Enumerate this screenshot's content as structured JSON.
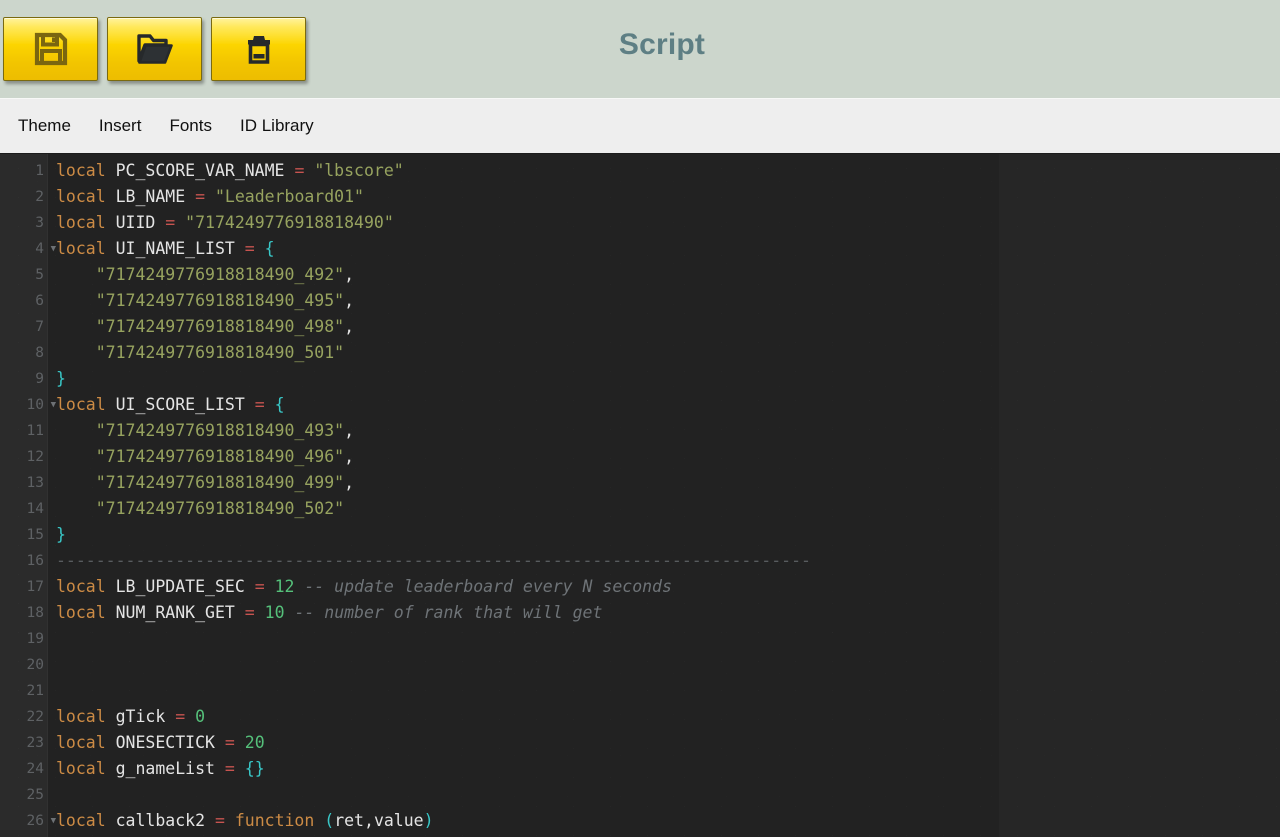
{
  "window": {
    "title": "Script",
    "title_color": "#5e7f84",
    "header_bg": "#ccd6cc",
    "menubar_bg": "#eeeeee",
    "editor_bg": "#222222",
    "gutter_bg": "#2b2b2b"
  },
  "toolbar": {
    "buttons": [
      {
        "name": "save-button",
        "icon": "floppy-disk-icon",
        "label": "Save"
      },
      {
        "name": "open-button",
        "icon": "folder-open-icon",
        "label": "Open"
      },
      {
        "name": "delete-button",
        "icon": "trash-can-icon",
        "label": "Delete"
      }
    ]
  },
  "menu": {
    "items": [
      {
        "label": "Theme"
      },
      {
        "label": "Insert"
      },
      {
        "label": "Fonts"
      },
      {
        "label": "ID Library"
      }
    ]
  },
  "editor": {
    "language": "lua",
    "first_line": 1,
    "last_line": 26,
    "fold_markers": [
      4,
      10,
      26
    ],
    "syntax_colors": {
      "keyword": "#cc8b45",
      "identifier": "#e4e4e4",
      "operator": "#c75450",
      "string": "#97a35f",
      "number": "#55c07a",
      "brace": "#39c8c8",
      "comment": "#6e7377",
      "linenumber": "#5e6164"
    },
    "lines": [
      {
        "n": 1,
        "tokens": [
          {
            "t": "kw",
            "v": "local"
          },
          {
            "t": "pun",
            "v": " "
          },
          {
            "t": "id",
            "v": "PC_SCORE_VAR_NAME"
          },
          {
            "t": "pun",
            "v": " "
          },
          {
            "t": "op",
            "v": "="
          },
          {
            "t": "pun",
            "v": " "
          },
          {
            "t": "str",
            "v": "\"lbscore\""
          }
        ]
      },
      {
        "n": 2,
        "tokens": [
          {
            "t": "kw",
            "v": "local"
          },
          {
            "t": "pun",
            "v": " "
          },
          {
            "t": "id",
            "v": "LB_NAME"
          },
          {
            "t": "pun",
            "v": " "
          },
          {
            "t": "op",
            "v": "="
          },
          {
            "t": "pun",
            "v": " "
          },
          {
            "t": "str",
            "v": "\"Leaderboard01\""
          }
        ]
      },
      {
        "n": 3,
        "tokens": [
          {
            "t": "kw",
            "v": "local"
          },
          {
            "t": "pun",
            "v": " "
          },
          {
            "t": "id",
            "v": "UIID"
          },
          {
            "t": "pun",
            "v": " "
          },
          {
            "t": "op",
            "v": "="
          },
          {
            "t": "pun",
            "v": " "
          },
          {
            "t": "str",
            "v": "\"7174249776918818490\""
          }
        ]
      },
      {
        "n": 4,
        "tokens": [
          {
            "t": "kw",
            "v": "local"
          },
          {
            "t": "pun",
            "v": " "
          },
          {
            "t": "id",
            "v": "UI_NAME_LIST"
          },
          {
            "t": "pun",
            "v": " "
          },
          {
            "t": "op",
            "v": "="
          },
          {
            "t": "pun",
            "v": " "
          },
          {
            "t": "brc",
            "v": "{"
          }
        ]
      },
      {
        "n": 5,
        "tokens": [
          {
            "t": "pun",
            "v": "    "
          },
          {
            "t": "str",
            "v": "\"7174249776918818490_492\""
          },
          {
            "t": "pun",
            "v": ","
          }
        ]
      },
      {
        "n": 6,
        "tokens": [
          {
            "t": "pun",
            "v": "    "
          },
          {
            "t": "str",
            "v": "\"7174249776918818490_495\""
          },
          {
            "t": "pun",
            "v": ","
          }
        ]
      },
      {
        "n": 7,
        "tokens": [
          {
            "t": "pun",
            "v": "    "
          },
          {
            "t": "str",
            "v": "\"7174249776918818490_498\""
          },
          {
            "t": "pun",
            "v": ","
          }
        ]
      },
      {
        "n": 8,
        "tokens": [
          {
            "t": "pun",
            "v": "    "
          },
          {
            "t": "str",
            "v": "\"7174249776918818490_501\""
          }
        ]
      },
      {
        "n": 9,
        "tokens": [
          {
            "t": "brc",
            "v": "}"
          }
        ]
      },
      {
        "n": 10,
        "tokens": [
          {
            "t": "kw",
            "v": "local"
          },
          {
            "t": "pun",
            "v": " "
          },
          {
            "t": "id",
            "v": "UI_SCORE_LIST"
          },
          {
            "t": "pun",
            "v": " "
          },
          {
            "t": "op",
            "v": "="
          },
          {
            "t": "pun",
            "v": " "
          },
          {
            "t": "brc",
            "v": "{"
          }
        ]
      },
      {
        "n": 11,
        "tokens": [
          {
            "t": "pun",
            "v": "    "
          },
          {
            "t": "str",
            "v": "\"7174249776918818490_493\""
          },
          {
            "t": "pun",
            "v": ","
          }
        ]
      },
      {
        "n": 12,
        "tokens": [
          {
            "t": "pun",
            "v": "    "
          },
          {
            "t": "str",
            "v": "\"7174249776918818490_496\""
          },
          {
            "t": "pun",
            "v": ","
          }
        ]
      },
      {
        "n": 13,
        "tokens": [
          {
            "t": "pun",
            "v": "    "
          },
          {
            "t": "str",
            "v": "\"7174249776918818490_499\""
          },
          {
            "t": "pun",
            "v": ","
          }
        ]
      },
      {
        "n": 14,
        "tokens": [
          {
            "t": "pun",
            "v": "    "
          },
          {
            "t": "str",
            "v": "\"7174249776918818490_502\""
          }
        ]
      },
      {
        "n": 15,
        "tokens": [
          {
            "t": "brc",
            "v": "}"
          }
        ]
      },
      {
        "n": 16,
        "tokens": [
          {
            "t": "comd",
            "v": "----------------------------------------------------------------------------"
          }
        ]
      },
      {
        "n": 17,
        "tokens": [
          {
            "t": "kw",
            "v": "local"
          },
          {
            "t": "pun",
            "v": " "
          },
          {
            "t": "id",
            "v": "LB_UPDATE_SEC"
          },
          {
            "t": "pun",
            "v": " "
          },
          {
            "t": "op",
            "v": "="
          },
          {
            "t": "pun",
            "v": " "
          },
          {
            "t": "num",
            "v": "12"
          },
          {
            "t": "pun",
            "v": " "
          },
          {
            "t": "com",
            "v": "-- update leaderboard every N seconds"
          }
        ]
      },
      {
        "n": 18,
        "tokens": [
          {
            "t": "kw",
            "v": "local"
          },
          {
            "t": "pun",
            "v": " "
          },
          {
            "t": "id",
            "v": "NUM_RANK_GET"
          },
          {
            "t": "pun",
            "v": " "
          },
          {
            "t": "op",
            "v": "="
          },
          {
            "t": "pun",
            "v": " "
          },
          {
            "t": "num",
            "v": "10"
          },
          {
            "t": "pun",
            "v": " "
          },
          {
            "t": "com",
            "v": "-- number of rank that will get"
          }
        ]
      },
      {
        "n": 19,
        "tokens": []
      },
      {
        "n": 20,
        "tokens": []
      },
      {
        "n": 21,
        "tokens": []
      },
      {
        "n": 22,
        "tokens": [
          {
            "t": "kw",
            "v": "local"
          },
          {
            "t": "pun",
            "v": " "
          },
          {
            "t": "id",
            "v": "gTick"
          },
          {
            "t": "pun",
            "v": " "
          },
          {
            "t": "op",
            "v": "="
          },
          {
            "t": "pun",
            "v": " "
          },
          {
            "t": "num",
            "v": "0"
          }
        ]
      },
      {
        "n": 23,
        "tokens": [
          {
            "t": "kw",
            "v": "local"
          },
          {
            "t": "pun",
            "v": " "
          },
          {
            "t": "id",
            "v": "ONESECTICK"
          },
          {
            "t": "pun",
            "v": " "
          },
          {
            "t": "op",
            "v": "="
          },
          {
            "t": "pun",
            "v": " "
          },
          {
            "t": "num",
            "v": "20"
          }
        ]
      },
      {
        "n": 24,
        "tokens": [
          {
            "t": "kw",
            "v": "local"
          },
          {
            "t": "pun",
            "v": " "
          },
          {
            "t": "id",
            "v": "g_nameList"
          },
          {
            "t": "pun",
            "v": " "
          },
          {
            "t": "op",
            "v": "="
          },
          {
            "t": "pun",
            "v": " "
          },
          {
            "t": "brc",
            "v": "{}"
          }
        ]
      },
      {
        "n": 25,
        "tokens": []
      },
      {
        "n": 26,
        "tokens": [
          {
            "t": "kw",
            "v": "local"
          },
          {
            "t": "pun",
            "v": " "
          },
          {
            "t": "id",
            "v": "callback2"
          },
          {
            "t": "pun",
            "v": " "
          },
          {
            "t": "op",
            "v": "="
          },
          {
            "t": "pun",
            "v": " "
          },
          {
            "t": "kw",
            "v": "function"
          },
          {
            "t": "pun",
            "v": " "
          },
          {
            "t": "par",
            "v": "("
          },
          {
            "t": "id",
            "v": "ret"
          },
          {
            "t": "pun",
            "v": ","
          },
          {
            "t": "id",
            "v": "value"
          },
          {
            "t": "par",
            "v": ")"
          }
        ]
      }
    ]
  }
}
